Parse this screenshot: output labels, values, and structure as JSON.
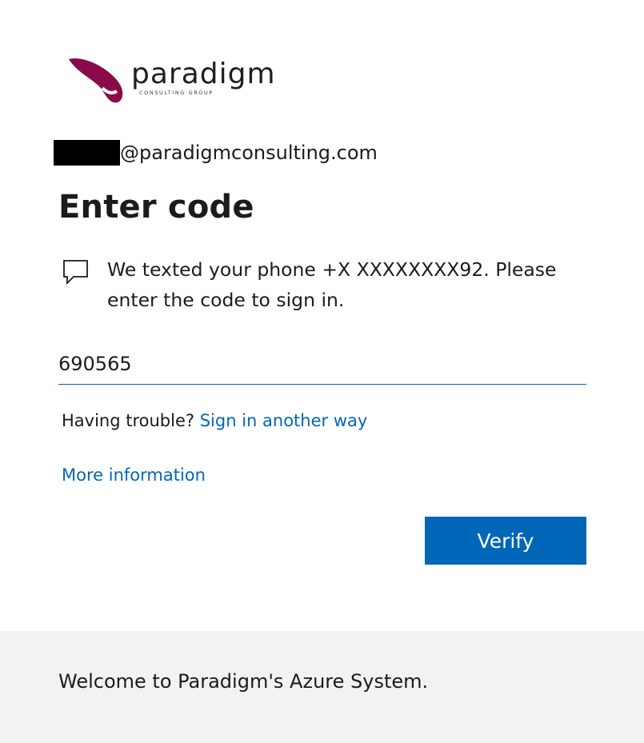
{
  "logo": {
    "name": "paradigm",
    "tagline": "CONSULTING GROUP",
    "brand_color": "#8b0a4a"
  },
  "identity": {
    "email_suffix": "@paradigmconsulting.com"
  },
  "page": {
    "title": "Enter code",
    "message": "We texted your phone +X XXXXXXXX92. Please enter the code to sign in.",
    "message_icon": "chat-bubble-icon"
  },
  "code_field": {
    "value": "690565"
  },
  "trouble": {
    "prefix": "Having trouble? ",
    "link": "Sign in another way"
  },
  "more_info": "More information",
  "verify_label": "Verify",
  "footer": {
    "text": "Welcome to Paradigm's Azure System."
  },
  "colors": {
    "accent": "#0067b8",
    "footer_bg": "#f2f2f2"
  }
}
